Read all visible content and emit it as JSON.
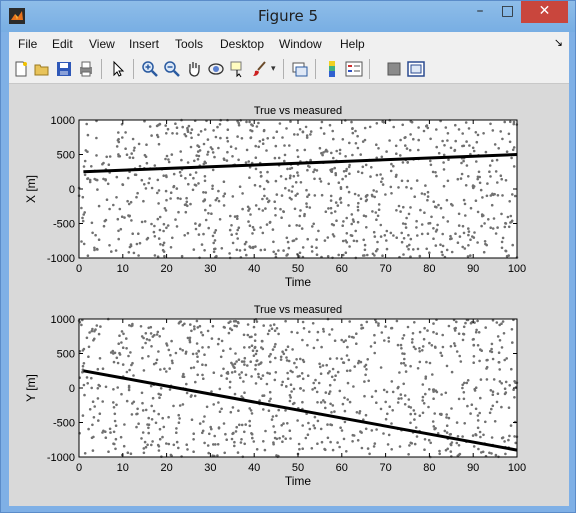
{
  "window": {
    "title": "Figure 5"
  },
  "menu": [
    "File",
    "Edit",
    "View",
    "Insert",
    "Tools",
    "Desktop",
    "Window",
    "Help"
  ],
  "toolbar_icons": [
    "new-figure-icon",
    "open-file-icon",
    "save-icon",
    "print-icon",
    "edit-plot-arrow-icon",
    "zoom-in-icon",
    "zoom-out-icon",
    "pan-hand-icon",
    "rotate-3d-icon",
    "data-cursor-icon",
    "brush-icon",
    "brush-dropdown-icon",
    "link-plot-icon",
    "insert-colorbar-icon",
    "insert-legend-icon",
    "hide-plot-tools-icon",
    "show-plot-tools-icon"
  ],
  "chart_data": [
    {
      "type": "scatter",
      "title": "True vs measured",
      "xlabel": "Time",
      "ylabel": "X [m]",
      "xlim": [
        0,
        100
      ],
      "ylim": [
        -1000,
        1000
      ],
      "xticks": [
        0,
        10,
        20,
        30,
        40,
        50,
        60,
        70,
        80,
        90,
        100
      ],
      "yticks": [
        -1000,
        -500,
        0,
        500,
        1000
      ],
      "grid": false,
      "series": [
        {
          "kind": "measured",
          "marker": "dots",
          "color": "#707070",
          "points": 1000,
          "x_range": [
            0,
            100
          ],
          "y_range": [
            -1000,
            1000
          ]
        },
        {
          "kind": "true",
          "line": "solid",
          "color": "#000000",
          "x": [
            1,
            100
          ],
          "y": [
            250,
            500
          ]
        }
      ]
    },
    {
      "type": "scatter",
      "title": "True vs measured",
      "xlabel": "Time",
      "ylabel": "Y [m]",
      "xlim": [
        0,
        100
      ],
      "ylim": [
        -1000,
        1000
      ],
      "xticks": [
        0,
        10,
        20,
        30,
        40,
        50,
        60,
        70,
        80,
        90,
        100
      ],
      "yticks": [
        -1000,
        -500,
        0,
        500,
        1000
      ],
      "grid": false,
      "series": [
        {
          "kind": "measured",
          "marker": "dots",
          "color": "#707070",
          "points": 1000,
          "x_range": [
            0,
            100
          ],
          "y_range": [
            -1000,
            1000
          ]
        },
        {
          "kind": "true",
          "line": "solid",
          "color": "#000000",
          "x": [
            1,
            100
          ],
          "y": [
            250,
            -900
          ]
        }
      ]
    }
  ]
}
